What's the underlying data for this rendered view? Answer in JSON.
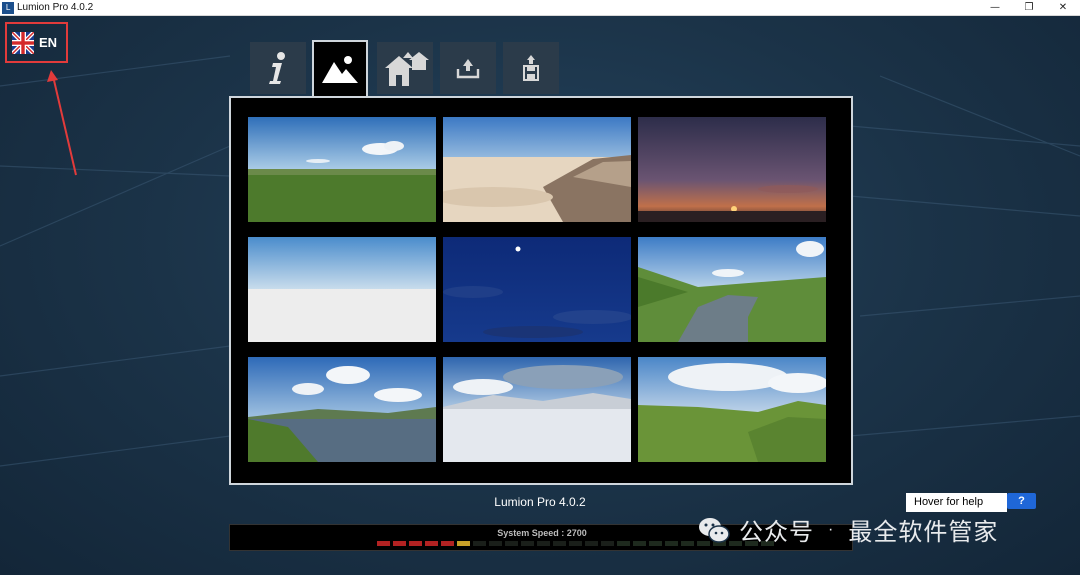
{
  "window": {
    "title": "Lumion Pro 4.0.2",
    "controls": [
      "—",
      "❐",
      "✕"
    ]
  },
  "language": {
    "code": "EN",
    "flag": "uk-flag"
  },
  "tabs": [
    {
      "name": "info",
      "icon": "info-icon",
      "active": false
    },
    {
      "name": "landscape",
      "icon": "landscape-icon",
      "active": true
    },
    {
      "name": "new-scene",
      "icon": "house-icon",
      "active": false
    },
    {
      "name": "import",
      "icon": "download-tray-icon",
      "active": false
    },
    {
      "name": "save",
      "icon": "save-disk-icon",
      "active": false
    }
  ],
  "scenes": [
    {
      "name": "grassland"
    },
    {
      "name": "desert"
    },
    {
      "name": "sunset"
    },
    {
      "name": "white"
    },
    {
      "name": "night"
    },
    {
      "name": "river-valley"
    },
    {
      "name": "lake-coast"
    },
    {
      "name": "snow-plain"
    },
    {
      "name": "green-hills"
    }
  ],
  "footer": {
    "version": "Lumion Pro 4.0.2",
    "speed_label": "System Speed : 2700",
    "speed_level": 6,
    "speed_segments": 25
  },
  "help": {
    "text": "Hover for help",
    "button": "?"
  },
  "watermark": {
    "left": "公众号",
    "right": "最全软件管家"
  },
  "colors": {
    "accent_blue": "#1f67d8",
    "highlight_red": "#e23b3b",
    "speed_red": "#b22222",
    "speed_yellow": "#c8a028"
  }
}
